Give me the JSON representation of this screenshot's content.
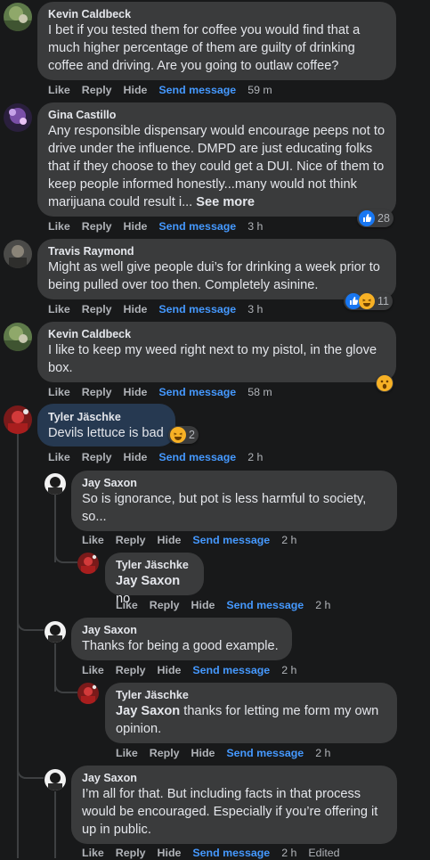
{
  "comments": [
    {
      "author": "Kevin Caldbeck",
      "text": "I bet if you tested them for coffee you would find that a much higher percentage of them are guilty of drinking coffee and driving. Are you going to outlaw coffee?",
      "actions": {
        "like": "Like",
        "reply": "Reply",
        "hide": "Hide",
        "send": "Send message",
        "time": "59 m"
      }
    },
    {
      "author": "Gina Castillo",
      "text": "Any responsible dispensary would encourage peeps not to drive under the influence. DMPD are just educating folks that if they choose to they could get a DUI. Nice of them to keep people informed honestly...many would not think marijuana could result i...",
      "see_more": "See more",
      "reactions": {
        "icons": [
          "like-reaction-icon"
        ],
        "count": "28"
      },
      "actions": {
        "like": "Like",
        "reply": "Reply",
        "hide": "Hide",
        "send": "Send message",
        "time": "3 h"
      }
    },
    {
      "author": "Travis Raymond",
      "text": "Might as well give people dui’s for drinking a week prior to being pulled over too then. Completely asinine.",
      "reactions": {
        "icons": [
          "like-reaction-icon",
          "haha-reaction-icon"
        ],
        "count": "11"
      },
      "actions": {
        "like": "Like",
        "reply": "Reply",
        "hide": "Hide",
        "send": "Send message",
        "time": "3 h"
      }
    },
    {
      "author": "Kevin Caldbeck",
      "text": "I like to keep my weed right next to my pistol, in the glove box.",
      "reactions": {
        "icons": [
          "wow-reaction-icon"
        ],
        "count": ""
      },
      "actions": {
        "like": "Like",
        "reply": "Reply",
        "hide": "Hide",
        "send": "Send message",
        "time": "58 m"
      }
    },
    {
      "author": "Tyler Jäschke",
      "text": "Devils lettuce is bad",
      "reactions": {
        "icons": [
          "haha-reaction-icon"
        ],
        "count": "2"
      },
      "actions": {
        "like": "Like",
        "reply": "Reply",
        "hide": "Hide",
        "send": "Send message",
        "time": "2 h"
      }
    }
  ],
  "replies": [
    {
      "author": "Jay Saxon",
      "text": "So is ignorance, but pot is less harmful to society, so...",
      "actions": {
        "like": "Like",
        "reply": "Reply",
        "hide": "Hide",
        "send": "Send message",
        "time": "2 h"
      }
    },
    {
      "author": "Tyler Jäschke",
      "mention": "Jay Saxon",
      "text": "no",
      "actions": {
        "like": "Like",
        "reply": "Reply",
        "hide": "Hide",
        "send": "Send message",
        "time": "2 h"
      }
    },
    {
      "author": "Jay Saxon",
      "text": "Thanks for being a good example.",
      "actions": {
        "like": "Like",
        "reply": "Reply",
        "hide": "Hide",
        "send": "Send message",
        "time": "2 h"
      }
    },
    {
      "author": "Tyler Jäschke",
      "mention": "Jay Saxon",
      "text": "thanks for letting me form my own opinion.",
      "actions": {
        "like": "Like",
        "reply": "Reply",
        "hide": "Hide",
        "send": "Send message",
        "time": "2 h"
      }
    },
    {
      "author": "Jay Saxon",
      "text": "I’m all for that. But including facts in that process would be encouraged. Especially if you’re offering it up in public.",
      "actions": {
        "like": "Like",
        "reply": "Reply",
        "hide": "Hide",
        "send": "Send message",
        "time": "2 h",
        "edited": "Edited"
      }
    }
  ],
  "colors": {
    "background": "#18191a",
    "bubble": "#3a3b3c",
    "highlight_bubble": "#263951",
    "link": "#4599ff",
    "secondary_text": "#b0b3b8"
  }
}
